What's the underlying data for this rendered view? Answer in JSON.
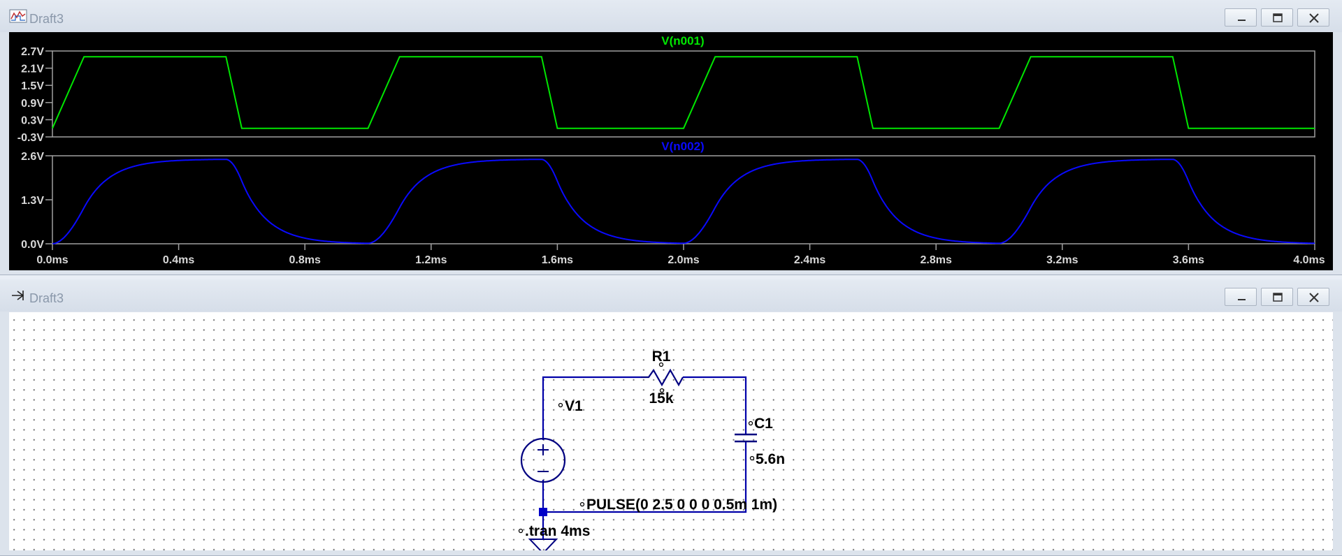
{
  "plot_window": {
    "title": "Draft3",
    "icon": "waveform-viewer-icon",
    "buttons": {
      "minimize": "minimize-icon",
      "maximize": "maximize-icon",
      "close": "close-icon"
    }
  },
  "schematic_window": {
    "title": "Draft3",
    "icon": "schematic-icon",
    "buttons": {
      "minimize": "minimize-icon",
      "maximize": "maximize-icon",
      "close": "close-icon"
    }
  },
  "colors": {
    "trace1": "#00e600",
    "trace2": "#0a0aff",
    "wire": "#0000a8"
  },
  "chart_data": [
    {
      "type": "line",
      "title": "V(n001)",
      "yticks": [
        "2.7V",
        "2.1V",
        "1.5V",
        "0.9V",
        "0.3V",
        "-0.3V"
      ],
      "ylim": [
        -0.3,
        2.7
      ],
      "xlim": [
        0,
        4
      ],
      "series": [
        {
          "name": "V(n001)",
          "x": [
            0,
            0.1,
            0.55,
            0.6,
            1.0,
            1.1,
            1.55,
            1.6,
            2.0,
            2.1,
            2.55,
            2.6,
            3.0,
            3.1,
            3.55,
            3.6,
            4.0
          ],
          "y": [
            0,
            2.5,
            2.5,
            0,
            0,
            2.5,
            2.5,
            0,
            0,
            2.5,
            2.5,
            0,
            0,
            2.5,
            2.5,
            0,
            0
          ]
        }
      ]
    },
    {
      "type": "line",
      "title": "V(n002)",
      "yticks": [
        "2.6V",
        "1.3V",
        "0.0V"
      ],
      "ylim": [
        0,
        2.6
      ],
      "xlim": [
        0,
        4
      ],
      "xticks": [
        "0.0ms",
        "0.4ms",
        "0.8ms",
        "1.2ms",
        "1.6ms",
        "2.0ms",
        "2.4ms",
        "2.8ms",
        "3.2ms",
        "3.6ms",
        "4.0ms"
      ],
      "series": [
        {
          "name": "V(n002)",
          "model": "rc-charge",
          "tau_ms": 0.084,
          "high": 2.5
        }
      ]
    }
  ],
  "schematic": {
    "r1_name": "R1",
    "r1_value": "15k",
    "v1_name": "V1",
    "c1_name": "C1",
    "c1_value": "5.6n",
    "source_value": "PULSE(0 2.5 0 0 0 0.5m 1m)",
    "directive": ".tran 4ms"
  }
}
